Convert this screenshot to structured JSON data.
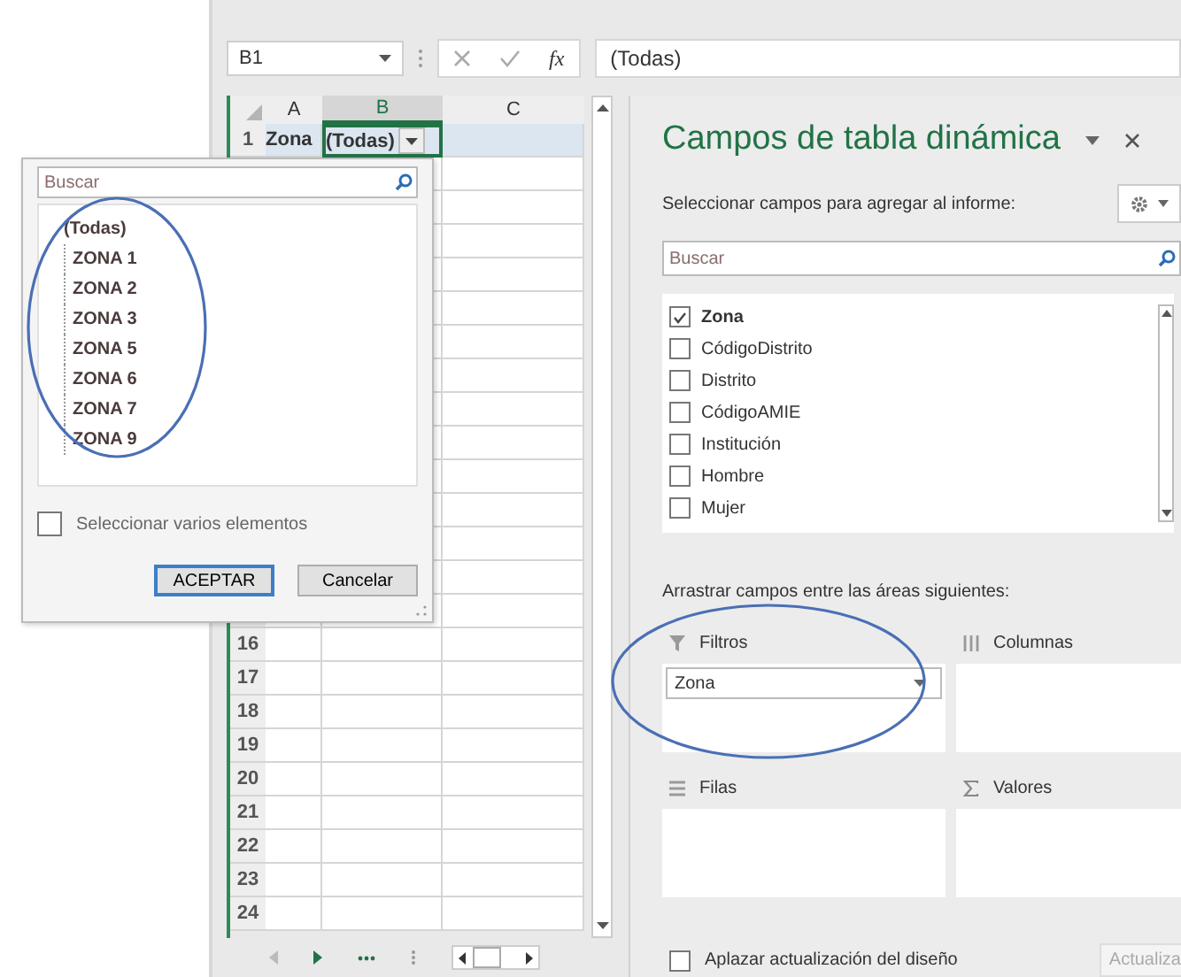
{
  "name_box": {
    "value": "B1"
  },
  "formula_bar": {
    "function_label": "fx",
    "value": "(Todas)"
  },
  "grid": {
    "columns": [
      {
        "label": "A",
        "selected": false
      },
      {
        "label": "B",
        "selected": true
      },
      {
        "label": "C",
        "selected": false
      }
    ],
    "rows": [
      {
        "number": "1",
        "cells": [
          {
            "text": "Zona",
            "selected": false,
            "filter": false
          },
          {
            "text": "(Todas)",
            "selected": true,
            "filter": true
          },
          {
            "text": "",
            "selected": false,
            "filter": false
          }
        ]
      },
      {
        "number": "16"
      },
      {
        "number": "17"
      },
      {
        "number": "18"
      },
      {
        "number": "19"
      },
      {
        "number": "20"
      },
      {
        "number": "21"
      },
      {
        "number": "22"
      },
      {
        "number": "23"
      },
      {
        "number": "24"
      }
    ]
  },
  "filter_popup": {
    "search": {
      "placeholder": "Buscar"
    },
    "items": [
      "(Todas)",
      "ZONA 1",
      "ZONA 2",
      "ZONA 3",
      "ZONA 5",
      "ZONA 6",
      "ZONA 7",
      "ZONA 9"
    ],
    "multi_select": {
      "label": "Seleccionar varios elementos",
      "checked": false
    },
    "buttons": [
      {
        "label": "ACEPTAR",
        "default": true
      },
      {
        "label": "Cancelar",
        "default": false
      }
    ]
  },
  "pivot_pane": {
    "title": "Campos de tabla dinámica",
    "subtitle": "Seleccionar campos para agregar al informe:",
    "search": {
      "placeholder": "Buscar"
    },
    "fields": [
      {
        "label": "Zona",
        "checked": true
      },
      {
        "label": "CódigoDistrito",
        "checked": false
      },
      {
        "label": "Distrito",
        "checked": false
      },
      {
        "label": "CódigoAMIE",
        "checked": false
      },
      {
        "label": "Institución",
        "checked": false
      },
      {
        "label": "Hombre",
        "checked": false
      },
      {
        "label": "Mujer",
        "checked": false
      }
    ],
    "areas_label": "Arrastrar campos entre las áreas siguientes:",
    "areas": [
      {
        "kind": "filters",
        "label": "Filtros",
        "items": [
          "Zona"
        ]
      },
      {
        "kind": "columns",
        "label": "Columnas"
      },
      {
        "kind": "rows",
        "label": "Filas"
      },
      {
        "kind": "values",
        "label": "Valores"
      }
    ],
    "defer": {
      "label": "Aplazar actualización del diseño",
      "checked": false
    },
    "update_button": "Actualiza"
  }
}
